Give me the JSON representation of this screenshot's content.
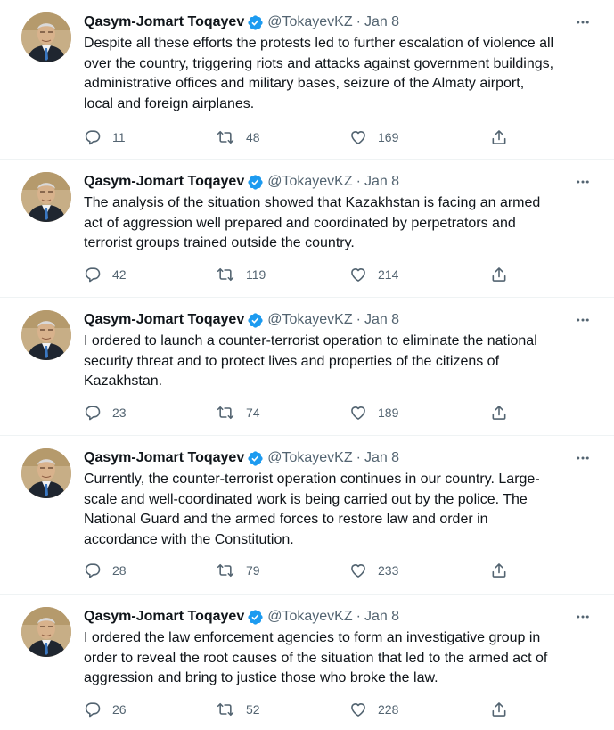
{
  "author": {
    "name": "Qasym-Jomart Toqayev",
    "handle": "@TokayevKZ",
    "separator": "·"
  },
  "colors": {
    "verified": "#1d9bf0",
    "meta_text": "#536471",
    "body_text": "#0f1419"
  },
  "icons": {
    "verified": "verified-badge-icon",
    "more": "more-options-icon",
    "reply": "reply-icon",
    "retweet": "retweet-icon",
    "like": "like-heart-icon",
    "share": "share-icon"
  },
  "tweets": [
    {
      "time": "Jan 8",
      "text": "Despite all these efforts the protests led to further escalation of violence all\nover the country, triggering riots and attacks against government buildings,\nadministrative offices and military bases, seizure of the Almaty airport,\nlocal and foreign airplanes.",
      "replies": "11",
      "retweets": "48",
      "likes": "169"
    },
    {
      "time": "Jan 8",
      "text": "The analysis of the situation showed that Kazakhstan is facing an armed\nact of aggression well prepared and coordinated by perpetrators and\nterrorist groups trained outside the country.",
      "replies": "42",
      "retweets": "119",
      "likes": "214"
    },
    {
      "time": "Jan 8",
      "text": "I ordered to launch a counter-terrorist operation to eliminate the national\nsecurity threat and to protect lives and properties of the citizens of\nKazakhstan.",
      "replies": "23",
      "retweets": "74",
      "likes": "189"
    },
    {
      "time": "Jan 8",
      "text": "Currently, the counter-terrorist operation continues in our country. Large-\nscale and well-coordinated work is being carried out by the police. The\nNational Guard and the armed forces to restore law and order in\naccordance with the Constitution.",
      "replies": "28",
      "retweets": "79",
      "likes": "233"
    },
    {
      "time": "Jan 8",
      "text": "I ordered the law enforcement agencies to form an investigative group in\norder to reveal the root causes of the situation that led to the armed act of\naggression and bring to justice those who broke the law.",
      "replies": "26",
      "retweets": "52",
      "likes": "228"
    }
  ]
}
